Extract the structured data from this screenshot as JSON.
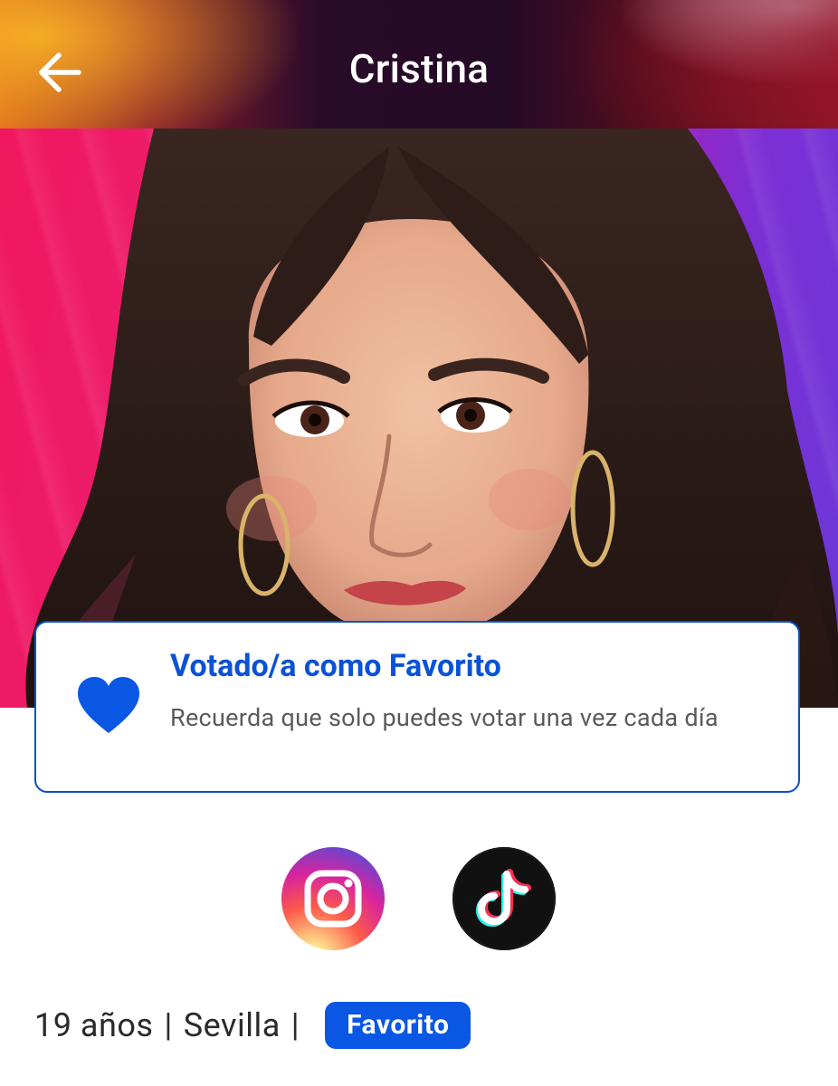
{
  "header": {
    "title": "Cristina",
    "back_icon": "arrow-left-icon"
  },
  "hero": {
    "image_alt": "Cristina"
  },
  "favorite_card": {
    "title": "Votado/a como Favorito",
    "message": "Recuerda que solo puedes votar una vez cada día",
    "icon": "heart-icon",
    "accent_color": "#0a52d6"
  },
  "social": [
    {
      "name": "instagram-icon"
    },
    {
      "name": "tiktok-icon"
    }
  ],
  "info": {
    "age": "19 años",
    "separator": "|",
    "city": "Sevilla",
    "badge": "Favorito"
  },
  "colors": {
    "primary_blue": "#0a57e4",
    "text_dark": "#2a2a2a",
    "text_muted": "#5a5a5a"
  }
}
